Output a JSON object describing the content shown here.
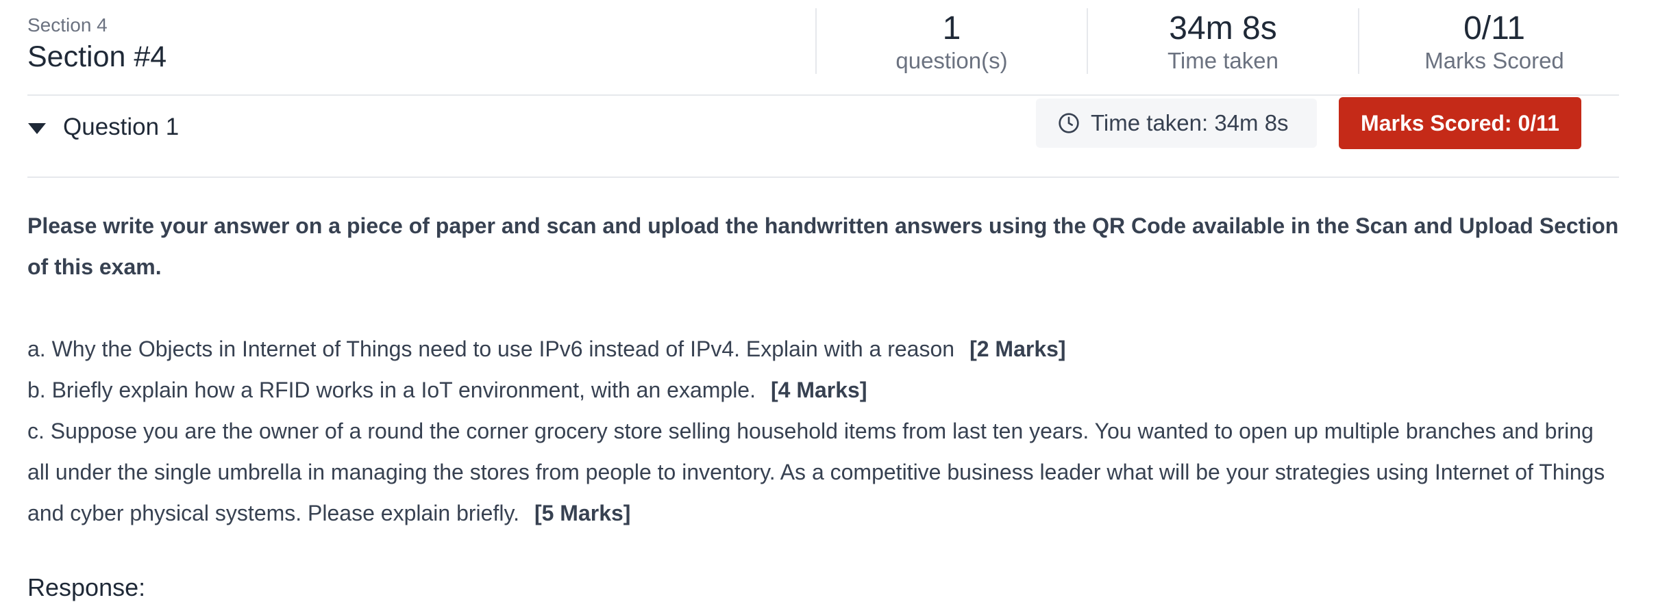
{
  "section": {
    "label": "Section 4",
    "title": "Section #4",
    "stats": [
      {
        "value": "1",
        "label": "question(s)"
      },
      {
        "value": "34m 8s",
        "label": "Time taken"
      },
      {
        "value": "0/11",
        "label": "Marks Scored"
      }
    ]
  },
  "question": {
    "title": "Question 1",
    "time_taken": "Time taken: 34m 8s",
    "marks_scored": "Marks Scored: 0/11",
    "accent_color": "#c52a18",
    "instruction": "Please write your answer on a piece of paper and scan and upload the handwritten answers using the QR Code available in the Scan and Upload Section of this exam.",
    "parts": [
      {
        "text": "a. Why the Objects in Internet of Things need to use IPv6 instead of IPv4. Explain with a reason",
        "marks": "[2 Marks]"
      },
      {
        "text": "b. Briefly explain how a RFID works in a IoT environment, with an example.",
        "marks": "[4 Marks]"
      },
      {
        "text": "c. Suppose you are the owner of a round the corner grocery store selling household items from last ten years. You wanted to open up multiple branches and bring all under the single umbrella in managing the stores from people to inventory. As a competitive business leader what will be your strategies using Internet of Things and cyber physical systems. Please explain briefly.",
        "marks": "[5 Marks]"
      }
    ],
    "response_label": "Response:"
  }
}
